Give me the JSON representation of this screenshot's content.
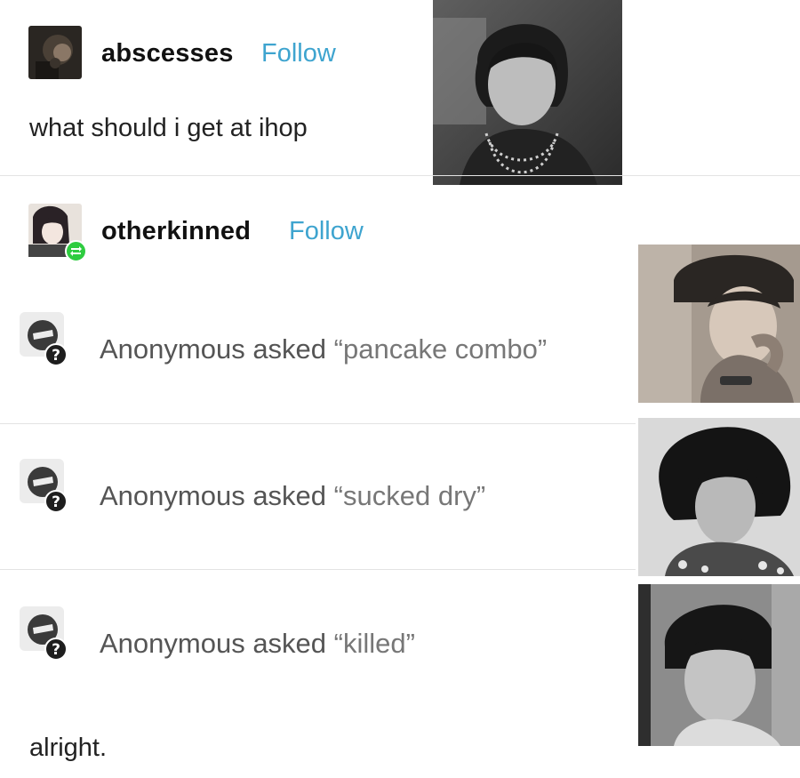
{
  "post1": {
    "username": "abscesses",
    "follow_label": "Follow",
    "text": "what should i get at ihop"
  },
  "post2": {
    "username": "otherkinned",
    "follow_label": "Follow",
    "reblog_icon": "reblog-icon"
  },
  "asks": [
    {
      "asker": "Anonymous asked",
      "question": "“pancake combo”"
    },
    {
      "asker": "Anonymous asked",
      "question": "“sucked dry”"
    },
    {
      "asker": "Anonymous asked",
      "question": "“killed”"
    }
  ],
  "closing_text": "alright.",
  "colors": {
    "follow": "#3ea4cf",
    "reblog_badge": "#2ecc40",
    "anon_icon": "#3a3a3a"
  },
  "icons": {
    "anon": "anonymous-question-icon",
    "reblog": "reblog-icon"
  }
}
